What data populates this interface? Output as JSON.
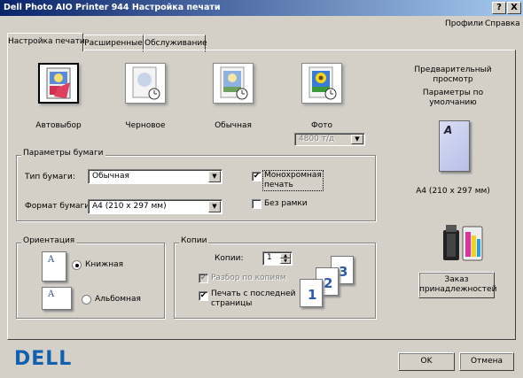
{
  "window": {
    "title": "Dell Photo AIO Printer 944 Настройка печати",
    "help_btn": "?",
    "close_btn": "X"
  },
  "menu": {
    "profiles": "Профили",
    "help": "Справка"
  },
  "tabs": [
    "Настройка печати",
    "Расширенные",
    "Обслуживание"
  ],
  "quality": {
    "options": [
      "Автовыбор",
      "Черновое",
      "Обычная",
      "Фото"
    ],
    "photo_dpi": "4800 т/д"
  },
  "paper": {
    "group_title": "Параметры бумаги",
    "type_label": "Тип бумаги:",
    "type_value": "Обычная",
    "size_label": "Формат бумаги:",
    "size_value": "A4 (210 x 297 мм)",
    "mono_label_1": "Монохромная",
    "mono_label_2": "печать",
    "mono_checked": "✔",
    "borderless_label": "Без рамки"
  },
  "orientation": {
    "group_title": "Ориентация",
    "portrait": "Книжная",
    "landscape": "Альбомная",
    "portrait_icon": "A",
    "landscape_icon": "A"
  },
  "copies": {
    "group_title": "Копии",
    "label": "Копии:",
    "value": "1",
    "collate_label": "Разбор по копиям",
    "collate_checked": "✔",
    "reverse_label_1": "Печать с последней",
    "reverse_label_2": "страницы",
    "reverse_checked": "✔",
    "page_numbers": [
      "1",
      "2",
      "3"
    ]
  },
  "preview": {
    "title_1": "Предварительный",
    "title_2": "просмотр",
    "subtitle_1": "Параметры по",
    "subtitle_2": "умолчанию",
    "page_letter": "A",
    "size_text": "A4 (210 x 297 мм)"
  },
  "supplies": {
    "label_1": "Заказ",
    "label_2": "принадлежностей"
  },
  "footer": {
    "brand": "DELL",
    "ok": "OK",
    "cancel": "Отмена"
  },
  "colors": {
    "title_start": "#0a246a",
    "title_end": "#a6caf0",
    "dell_blue": "#1060b0"
  }
}
